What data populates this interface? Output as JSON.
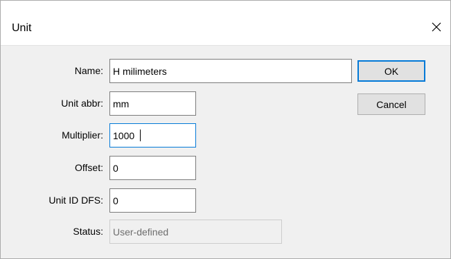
{
  "dialog": {
    "title": "Unit"
  },
  "form": {
    "name_label": "Name:",
    "name_value": "H milimeters",
    "abbr_label": "Unit abbr:",
    "abbr_value": "mm",
    "multiplier_label": "Multiplier:",
    "multiplier_value": "1000",
    "offset_label": "Offset:",
    "offset_value": "0",
    "dfs_label": "Unit ID DFS:",
    "dfs_value": "0",
    "status_label": "Status:",
    "status_value": "User-defined"
  },
  "buttons": {
    "ok_label": "OK",
    "cancel_label": "Cancel"
  },
  "icons": {
    "close": "close-icon"
  },
  "colors": {
    "focus_accent": "#0078d7",
    "button_face": "#e1e1e1",
    "dialog_background": "#f0f0f0"
  }
}
